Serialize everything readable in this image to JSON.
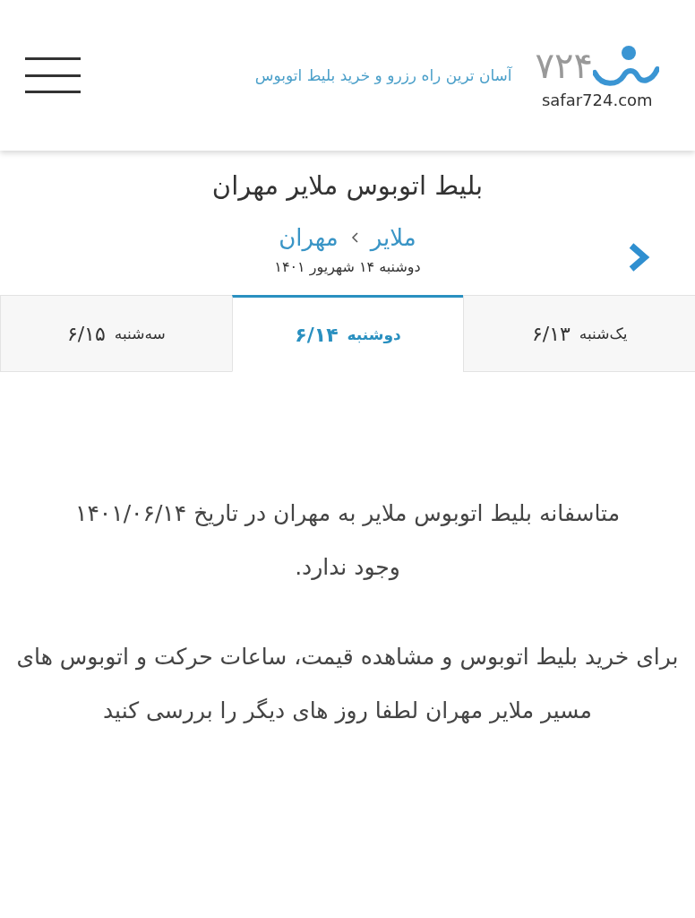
{
  "header": {
    "tagline": "آسان ترین راه رزرو و خرید بلیط اتوبوس",
    "logo_digits": "۷۲۴",
    "logo_domain": "safar724.com"
  },
  "title": "بلیط اتوبوس ملایر مهران",
  "route": {
    "origin": "ملایر",
    "destination": "مهران",
    "date": "دوشنبه ۱۴ شهریور ۱۴۰۱"
  },
  "day_tabs": [
    {
      "day": "یک‌شنبه",
      "date": "۶/۱۳",
      "selected": false
    },
    {
      "day": "دوشنبه",
      "date": "۶/۱۴",
      "selected": true
    },
    {
      "day": "سه‌شنبه",
      "date": "۶/۱۵",
      "selected": false
    }
  ],
  "messages": [
    "متاسفانه بلیط اتوبوس ملایر به مهران در تاریخ ۱۴۰۱/۰۶/۱۴ وجود ندارد.",
    "برای خرید بلیط اتوبوس و مشاهده قیمت، ساعات حرکت و اتوبوس های مسیر ملایر مهران لطفا روز های دیگر را بررسی کنید"
  ]
}
